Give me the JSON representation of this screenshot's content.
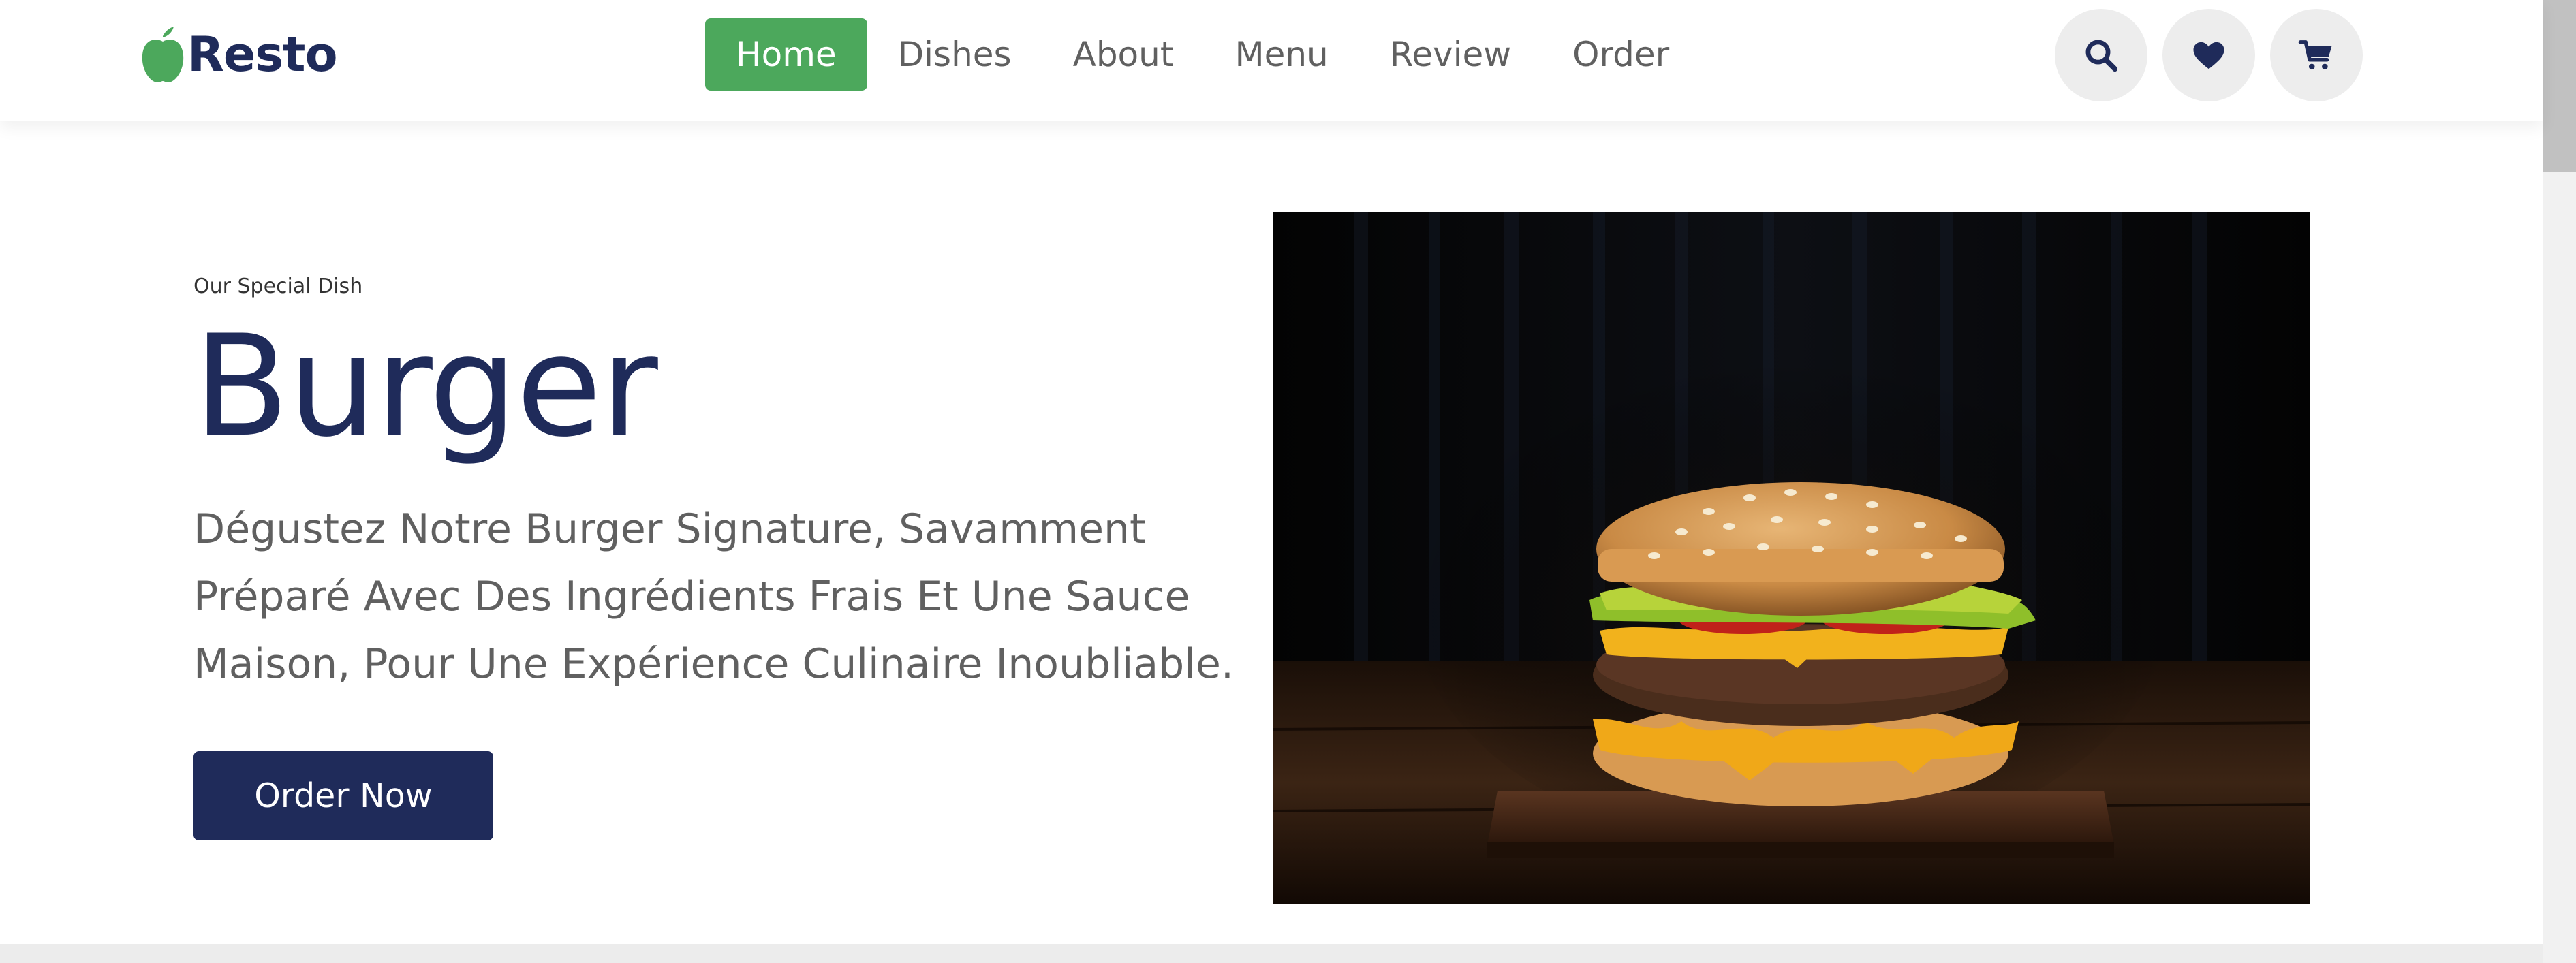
{
  "brand": {
    "name": "Resto",
    "logo_icon": "apple-icon",
    "accent_color": "#4ca85c",
    "primary_color": "#1f2b5a"
  },
  "nav": {
    "items": [
      {
        "label": "Home",
        "active": true
      },
      {
        "label": "Dishes",
        "active": false
      },
      {
        "label": "About",
        "active": false
      },
      {
        "label": "Menu",
        "active": false
      },
      {
        "label": "Review",
        "active": false
      },
      {
        "label": "Order",
        "active": false
      }
    ]
  },
  "actions": [
    {
      "icon": "search-icon"
    },
    {
      "icon": "heart-icon"
    },
    {
      "icon": "cart-icon"
    }
  ],
  "hero": {
    "eyebrow": "Our Special Dish",
    "title": "Burger",
    "description": "Dégustez Notre Burger Signature, Savamment Préparé Avec Des Ingrédients Frais Et Une Sauce Maison, Pour Une Expérience Culinaire Inoubliable.",
    "cta_label": "Order Now",
    "image_icon": "burger-image"
  }
}
